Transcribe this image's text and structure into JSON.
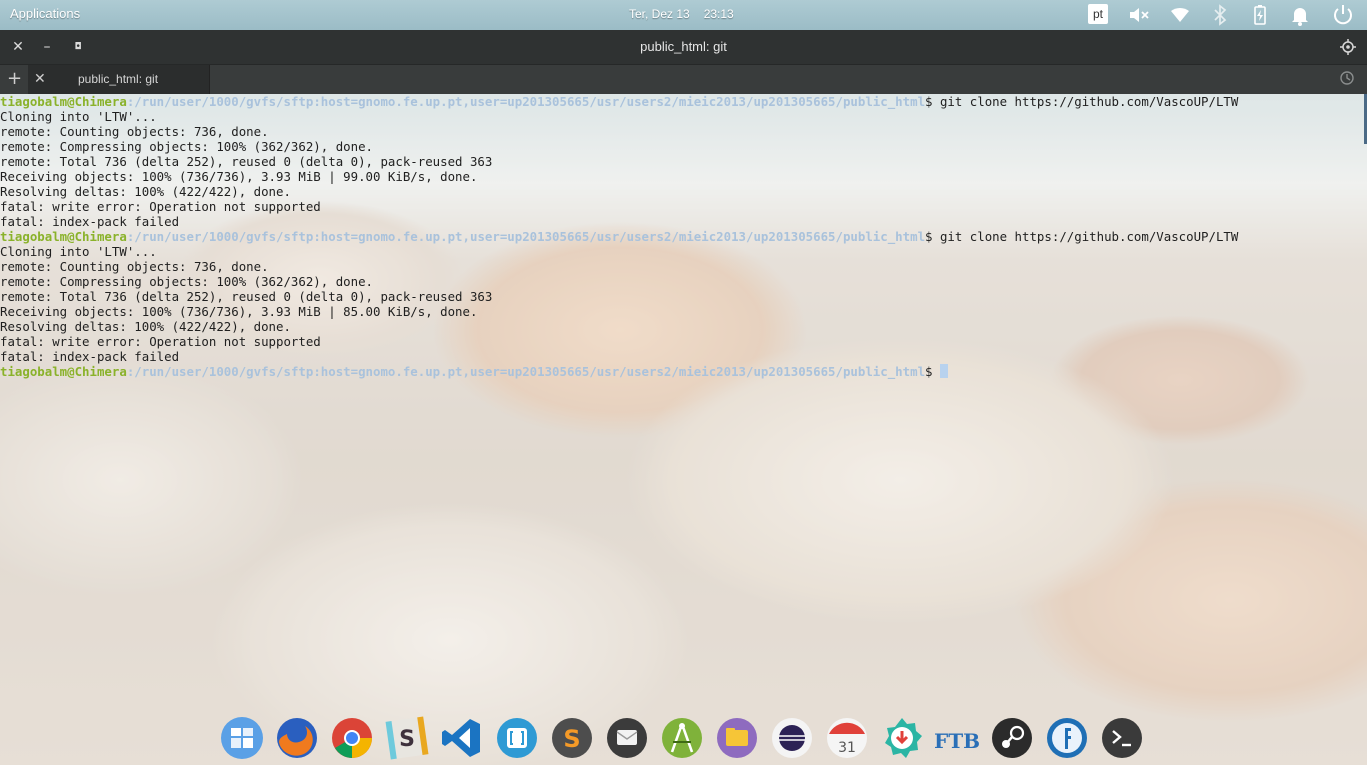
{
  "panel": {
    "applications_label": "Applications",
    "date": "Ter, Dez 13",
    "time": "23:13",
    "keyboard_layout": "pt"
  },
  "window": {
    "title": "public_html: git",
    "tab_label": "public_html: git"
  },
  "terminal": {
    "prompt_user": "tiagobalm@Chimera",
    "prompt_path": ":/run/user/1000/gvfs/sftp:host=gnomo.fe.up.pt,user=up201305665/usr/users2/mieic2013/up201305665/public_html",
    "prompt_symbol": "$",
    "command1": " git clone https://github.com/VascoUP/LTW",
    "output1": [
      "Cloning into 'LTW'...",
      "remote: Counting objects: 736, done.",
      "remote: Compressing objects: 100% (362/362), done.",
      "remote: Total 736 (delta 252), reused 0 (delta 0), pack-reused 363",
      "Receiving objects: 100% (736/736), 3.93 MiB | 99.00 KiB/s, done.",
      "Resolving deltas: 100% (422/422), done.",
      "fatal: write error: Operation not supported",
      "fatal: index-pack failed"
    ],
    "command2": " git clone https://github.com/VascoUP/LTW",
    "output2": [
      "Cloning into 'LTW'...",
      "remote: Counting objects: 736, done.",
      "remote: Compressing objects: 100% (362/362), done.",
      "remote: Total 736 (delta 252), reused 0 (delta 0), pack-reused 363",
      "Receiving objects: 100% (736/736), 3.93 MiB | 85.00 KiB/s, done.",
      "Resolving deltas: 100% (422/422), done.",
      "fatal: write error: Operation not supported",
      "fatal: index-pack failed"
    ]
  },
  "dock": {
    "items": [
      "multitasking-view",
      "firefox",
      "chrome",
      "slack",
      "visual-studio-code",
      "brackets",
      "sublime-text",
      "mail",
      "android-studio",
      "files",
      "eclipse",
      "calendar",
      "software-center",
      "ftb-launcher",
      "steam",
      "feedreader",
      "terminal"
    ],
    "calendar_day": "31",
    "ftb_text": "FTB"
  },
  "colors": {
    "prompt_user": "#8ab22a",
    "prompt_path": "#a9c2dc",
    "titlebar": "#2f3232",
    "panel": "#9bbcc6"
  }
}
